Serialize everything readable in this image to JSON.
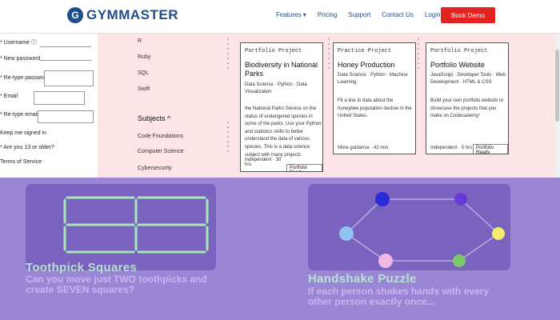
{
  "header": {
    "logo": "GYMMASTER",
    "nav": [
      "Features ▾",
      "Pricing",
      "Support",
      "Contact Us",
      "Login"
    ],
    "cta": "Book Demo"
  },
  "form": {
    "fields": [
      "* Username ⓘ",
      "* New password",
      "* Re-type password",
      "* Email",
      "* Re-type email"
    ],
    "keep_signed": "Keep me signed in",
    "age": "* Are you 13 or older?",
    "terms": "Terms of Service"
  },
  "languages": [
    "R",
    "Ruby",
    "SQL",
    "Swift"
  ],
  "subjects": {
    "heading": "Subjects ^",
    "items": [
      "Code Foundations",
      "Computer Science",
      "Cybersecurity"
    ]
  },
  "cards": [
    {
      "tag": "Portfolio Project",
      "title": "Biodiversity in National Parks",
      "tags": "Data Science · Python · Data Visualization",
      "desc": "the National Parks Service on the status of endangered species in some of the parks. Use your Python and statistics skills to better understand the data of various species. This is a data science subject with many projects",
      "time": "Independent · 30 hrs",
      "level": "Portfolio Ready"
    },
    {
      "tag": "Practice Project",
      "title": "Honey Production",
      "tags": "Data Science · Python · Machine Learning",
      "desc": "Fit a line to data about the honeybee population decline in the United States.",
      "time": "More guidance · 42 min",
      "level": ""
    },
    {
      "tag": "Portfolio Project",
      "title": "Portfolio Website",
      "tags": "JavaScript · Developer Tools · Web Development · HTML & CSS",
      "desc": "Build your own portfolio website to showcase the projects that you make on Codecademy!",
      "time": "Independent · 5 hrs",
      "level": "Portfolio Ready"
    }
  ],
  "puzzles": [
    {
      "title": "Toothpick Squares",
      "desc": "Can you move just TWO toothpicks and create SEVEN squares?"
    },
    {
      "title": "Handshake Puzzle",
      "desc": "If each person shakes hands with every other person exactly once..."
    }
  ],
  "colors": {
    "brand": "#1f4e8c",
    "cta": "#e32222",
    "pink_bg": "#fde4e7",
    "purple_bg": "#9b86d6",
    "toothpick": "#a6e8b4",
    "nodes": [
      "#2a2ad8",
      "#6a3ad8",
      "#f2ec6a",
      "#7cc96a",
      "#f0b8e8",
      "#8fc4f0"
    ]
  }
}
